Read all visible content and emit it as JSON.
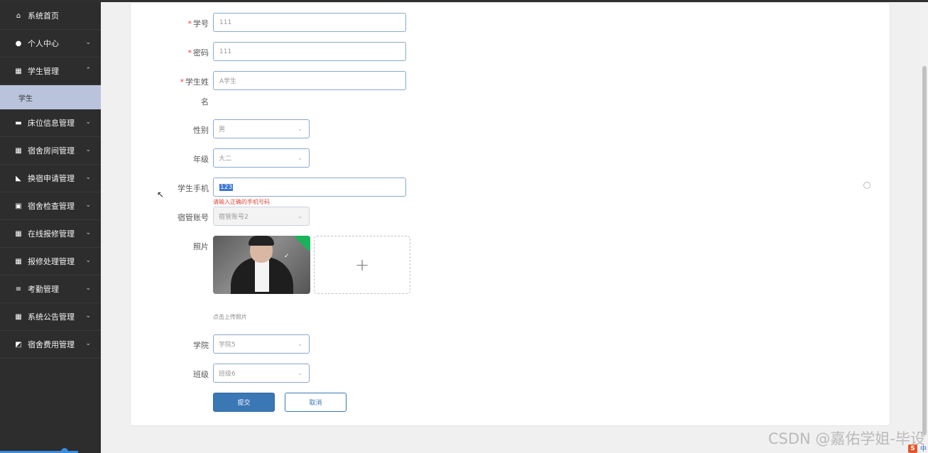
{
  "sidebar": {
    "items": [
      {
        "label": "系统首页",
        "icon": "home-icon",
        "glyph": "⌂",
        "chevron": ""
      },
      {
        "label": "个人中心",
        "icon": "user-icon",
        "glyph": "●",
        "chevron": "⌄"
      },
      {
        "label": "学生管理",
        "icon": "grid-icon",
        "glyph": "▦",
        "chevron": "⌃"
      },
      {
        "label": "床位信息管理",
        "icon": "comment-icon",
        "glyph": "▬",
        "chevron": "⌄"
      },
      {
        "label": "宿舍房间管理",
        "icon": "table-icon",
        "glyph": "▦",
        "chevron": "⌄"
      },
      {
        "label": "换宿申请管理",
        "icon": "thumb-icon",
        "glyph": "◣",
        "chevron": "⌄"
      },
      {
        "label": "宿舍检查管理",
        "icon": "clipboard-icon",
        "glyph": "▣",
        "chevron": "⌄"
      },
      {
        "label": "在线报修管理",
        "icon": "grid-icon",
        "glyph": "▦",
        "chevron": "⌄"
      },
      {
        "label": "报修处理管理",
        "icon": "grid-icon",
        "glyph": "▦",
        "chevron": "⌄"
      },
      {
        "label": "考勤管理",
        "icon": "sliders-icon",
        "glyph": "≡",
        "chevron": "⌄"
      },
      {
        "label": "系统公告管理",
        "icon": "grid-icon",
        "glyph": "▦",
        "chevron": "⌄"
      },
      {
        "label": "宿舍费用管理",
        "icon": "chart-icon",
        "glyph": "◩",
        "chevron": "⌄"
      }
    ],
    "submenu": {
      "label": "学生"
    }
  },
  "form": {
    "student_no": {
      "label": "学号",
      "value": "111"
    },
    "password": {
      "label": "密码",
      "value": "111"
    },
    "student_name": {
      "label_line1": "学生姓",
      "label_line2": "名",
      "value": "A学生"
    },
    "gender": {
      "label": "性别",
      "value": "男"
    },
    "grade": {
      "label": "年级",
      "value": "大二"
    },
    "phone": {
      "label": "学生手机",
      "value": "123",
      "error": "请输入正确的手机号码"
    },
    "dorm_account": {
      "label": "宿管账号",
      "value": "宿管账号2"
    },
    "photo": {
      "label": "照片",
      "hint": "点击上传照片",
      "add_glyph": "+"
    },
    "college": {
      "label": "学院",
      "value": "学院5"
    },
    "class": {
      "label": "班级",
      "value": "班级6"
    },
    "required_mark": "*",
    "submit_label": "提交",
    "cancel_label": "取消"
  },
  "watermark": "CSDN @嘉佑学姐-毕设",
  "tray": {
    "ime": "S",
    "lang": "中"
  }
}
